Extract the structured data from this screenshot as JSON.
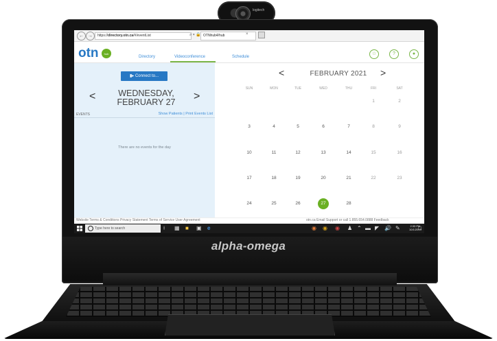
{
  "device": {
    "brand": "alpha-omega",
    "webcam_label": "logitech"
  },
  "browser": {
    "url_prefix": "https://",
    "url_host": "directory.otn.ca",
    "url_path": "/#/eventList",
    "url_tools": "⌕ ▾ 🔒 C",
    "tab_title": "OTNhub4/hub",
    "tab_close": "×"
  },
  "header": {
    "logo_text": "otn",
    "logo_sub": "hub",
    "menu": [
      "Directory",
      "Videoconference",
      "Schedule"
    ],
    "icons": [
      "star-icon",
      "chat-icon",
      "user-icon"
    ]
  },
  "left": {
    "connect_label": "Connect to...",
    "day_title_line1": "WEDNESDAY,",
    "day_title_line2": "FEBRUARY 27",
    "prev": "<",
    "next": ">",
    "events_label": "EVENTS",
    "events_links": "Show Patients | Print Events List",
    "no_events": "There are no events for the day"
  },
  "calendar": {
    "prev": "<",
    "next": ">",
    "title": "FEBRUARY 2021",
    "weekdays": [
      "SUN",
      "MON",
      "TUE",
      "WED",
      "THU",
      "FRI",
      "SAT"
    ],
    "weeks": [
      [
        "",
        "",
        "",
        "",
        "",
        "1",
        "2"
      ],
      [
        "3",
        "4",
        "5",
        "6",
        "7",
        "8",
        "9"
      ],
      [
        "10",
        "11",
        "12",
        "13",
        "14",
        "15",
        "16"
      ],
      [
        "17",
        "18",
        "19",
        "20",
        "21",
        "22",
        "23"
      ],
      [
        "24",
        "25",
        "26",
        "27",
        "28",
        "",
        ""
      ]
    ],
    "today": "27"
  },
  "footer": {
    "left": "Website Terms & Conditions    Privacy Statement    Terms of Service    User Agreement",
    "right": "otn.ca    Email Support or call 1.855.654.0888    Feedback"
  },
  "taskbar": {
    "search_placeholder": "Type here to search",
    "time": "2:33 PM",
    "date": "10/1/2019"
  },
  "colors": {
    "accent_green": "#6ab023",
    "link_blue": "#3f8ed8",
    "button_blue": "#2778c4",
    "pane_bg": "#e5f1fa"
  }
}
